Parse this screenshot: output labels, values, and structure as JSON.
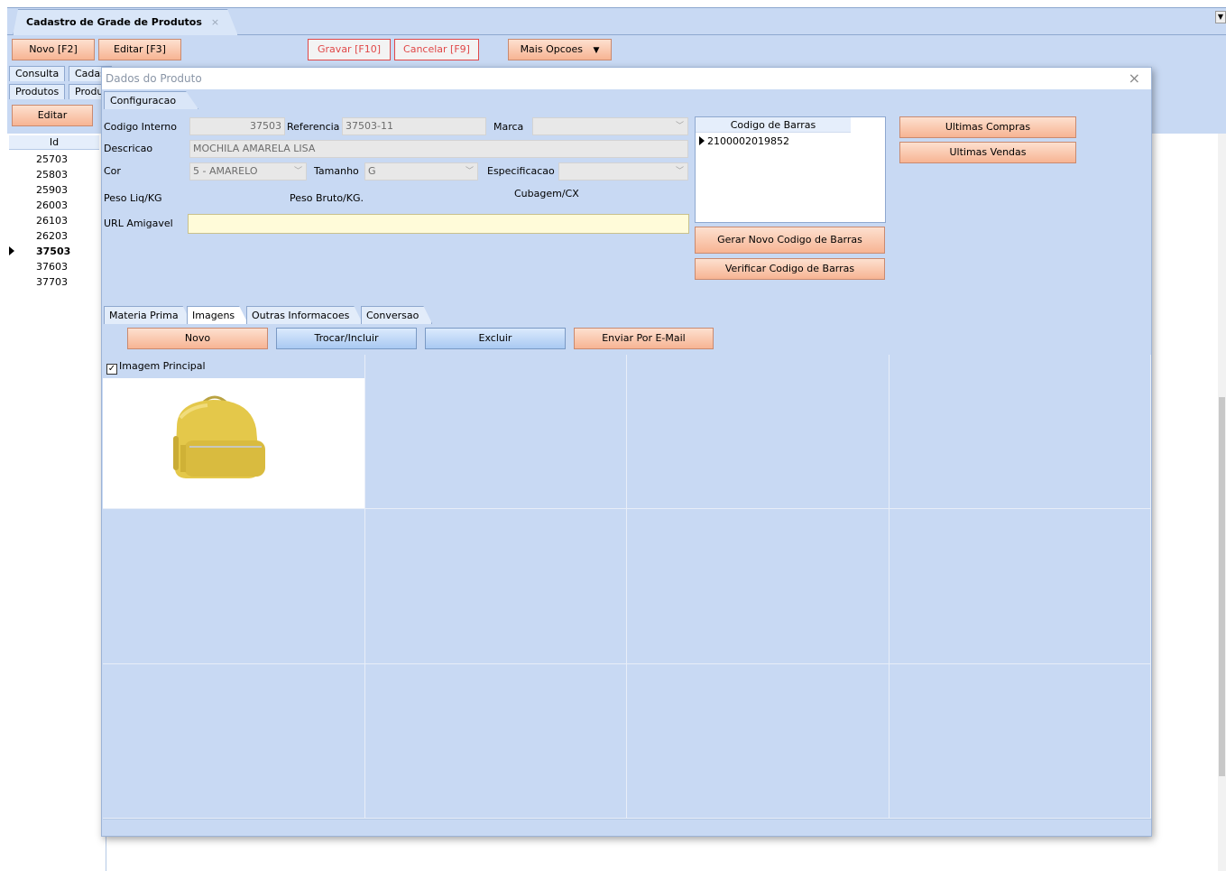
{
  "window": {
    "doc_tab": "Cadastro de Grade de Produtos",
    "close_glyph": "×"
  },
  "toolbar": {
    "novo": "Novo [F2]",
    "editar": "Editar [F3]",
    "gravar": "Gravar [F10]",
    "cancelar": "Cancelar [F9]",
    "mais_opcoes": "Mais Opcoes"
  },
  "background": {
    "tabs_row1": [
      "Consulta",
      "Cadas"
    ],
    "tabs_row2": [
      "Produtos",
      "Produ"
    ],
    "editar_button": "Editar",
    "list_header": "Id",
    "ids": [
      "25703",
      "25803",
      "25903",
      "26003",
      "26103",
      "26203",
      "37503",
      "37603",
      "37703"
    ],
    "selected_id": "37503"
  },
  "dialog": {
    "title": "Dados do Produto",
    "close": "×",
    "tab": "Configuracao",
    "labels": {
      "codigo_interno": "Codigo Interno",
      "referencia": "Referencia",
      "marca": "Marca",
      "descricao": "Descricao",
      "cor": "Cor",
      "tamanho": "Tamanho",
      "especificacao": "Especificacao",
      "peso_liq": "Peso Liq/KG",
      "peso_bruto": "Peso Bruto/KG.",
      "cubagem": "Cubagem/CX",
      "url_amigavel": "URL Amigavel"
    },
    "values": {
      "codigo_interno": "37503",
      "referencia": "37503-11",
      "marca": "",
      "descricao": "MOCHILA AMARELA LISA",
      "cor": "5 - AMARELO",
      "tamanho": "G",
      "especificacao": "",
      "url_amigavel": ""
    },
    "barcode": {
      "header": "Codigo de Barras",
      "rows": [
        "2100002019852"
      ]
    },
    "buttons": {
      "ultimas_compras": "Ultimas Compras",
      "ultimas_vendas": "Ultimas Vendas",
      "gerar_codigo": "Gerar Novo Codigo de Barras",
      "verificar_codigo": "Verificar Codigo de Barras"
    },
    "sub_tabs": [
      "Materia Prima",
      "Imagens",
      "Outras Informacoes",
      "Conversao"
    ],
    "active_sub_tab": "Imagens",
    "image_buttons": {
      "novo": "Novo",
      "trocar": "Trocar/Incluir",
      "excluir": "Excluir",
      "enviar": "Enviar Por E-Mail"
    },
    "image_grid": {
      "main_caption": "Imagem Principal",
      "main_checked": true,
      "rows": 3,
      "cols": 4
    }
  },
  "colors": {
    "panel_blue": "#c8d9f3",
    "peach_button": "#f7b493",
    "blue_button": "#a9c9f2",
    "red_outline": "#e04848",
    "url_field": "#fffbd9"
  }
}
